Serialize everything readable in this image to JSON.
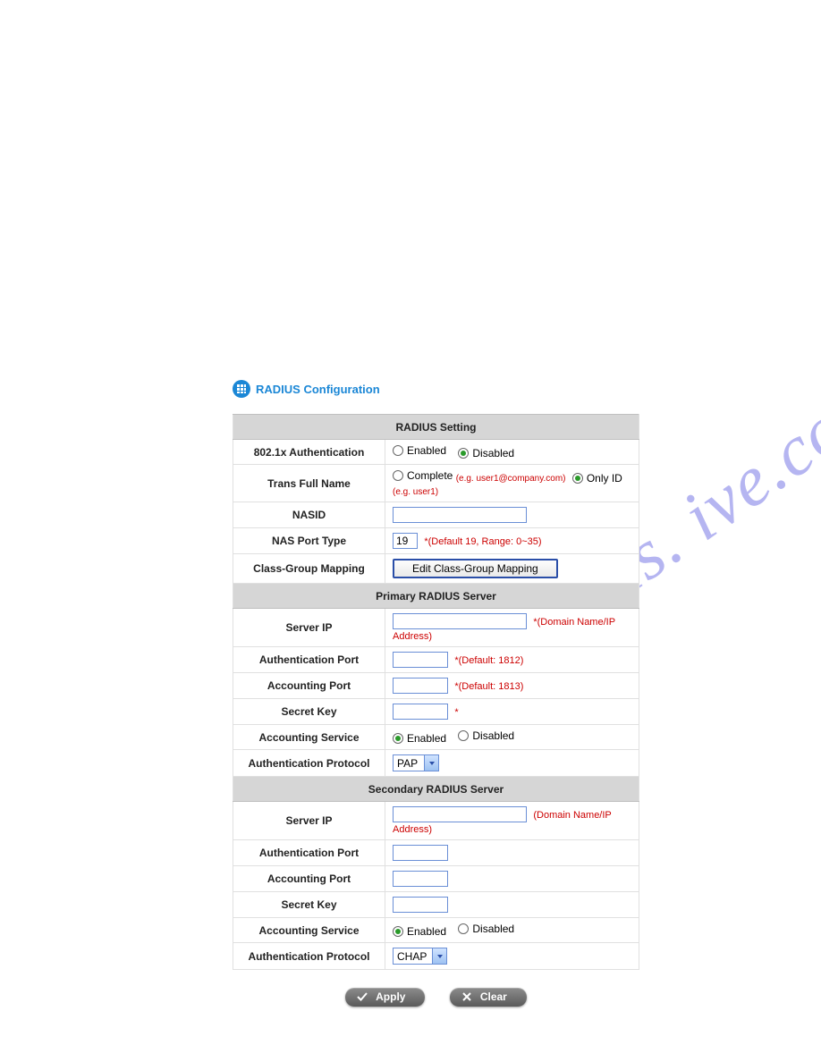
{
  "watermark": "manuals.  ive.com",
  "title": "RADIUS Configuration",
  "sections": {
    "setting": {
      "header": "RADIUS Setting",
      "auth8021x": {
        "label": "802.1x Authentication",
        "opt_enabled": "Enabled",
        "opt_disabled": "Disabled",
        "selected": "disabled"
      },
      "trans_full_name": {
        "label": "Trans Full Name",
        "opt_complete": "Complete",
        "eg_complete": "(e.g. user1@company.com)",
        "opt_onlyid": "Only ID",
        "eg_onlyid": "(e.g. user1)",
        "selected": "onlyid"
      },
      "nasid": {
        "label": "NASID",
        "value": ""
      },
      "nas_port_type": {
        "label": "NAS Port Type",
        "value": "19",
        "hint": "*(Default 19, Range: 0~35)"
      },
      "class_group": {
        "label": "Class-Group Mapping",
        "button": "Edit Class-Group Mapping"
      }
    },
    "primary": {
      "header": "Primary RADIUS Server",
      "server_ip": {
        "label": "Server IP",
        "value": "",
        "hint": "*(Domain Name/IP Address)"
      },
      "auth_port": {
        "label": "Authentication Port",
        "value": "",
        "hint": "*(Default: 1812)"
      },
      "acct_port": {
        "label": "Accounting Port",
        "value": "",
        "hint": "*(Default: 1813)"
      },
      "secret": {
        "label": "Secret Key",
        "value": "",
        "hint": "*"
      },
      "acct_svc": {
        "label": "Accounting Service",
        "opt_enabled": "Enabled",
        "opt_disabled": "Disabled",
        "selected": "enabled"
      },
      "auth_proto": {
        "label": "Authentication Protocol",
        "value": "PAP"
      }
    },
    "secondary": {
      "header": "Secondary RADIUS Server",
      "server_ip": {
        "label": "Server IP",
        "value": "",
        "hint": "(Domain Name/IP Address)"
      },
      "auth_port": {
        "label": "Authentication Port",
        "value": ""
      },
      "acct_port": {
        "label": "Accounting Port",
        "value": ""
      },
      "secret": {
        "label": "Secret Key",
        "value": ""
      },
      "acct_svc": {
        "label": "Accounting Service",
        "opt_enabled": "Enabled",
        "opt_disabled": "Disabled",
        "selected": "enabled"
      },
      "auth_proto": {
        "label": "Authentication Protocol",
        "value": "CHAP"
      }
    }
  },
  "footer": {
    "apply": "Apply",
    "clear": "Clear"
  }
}
